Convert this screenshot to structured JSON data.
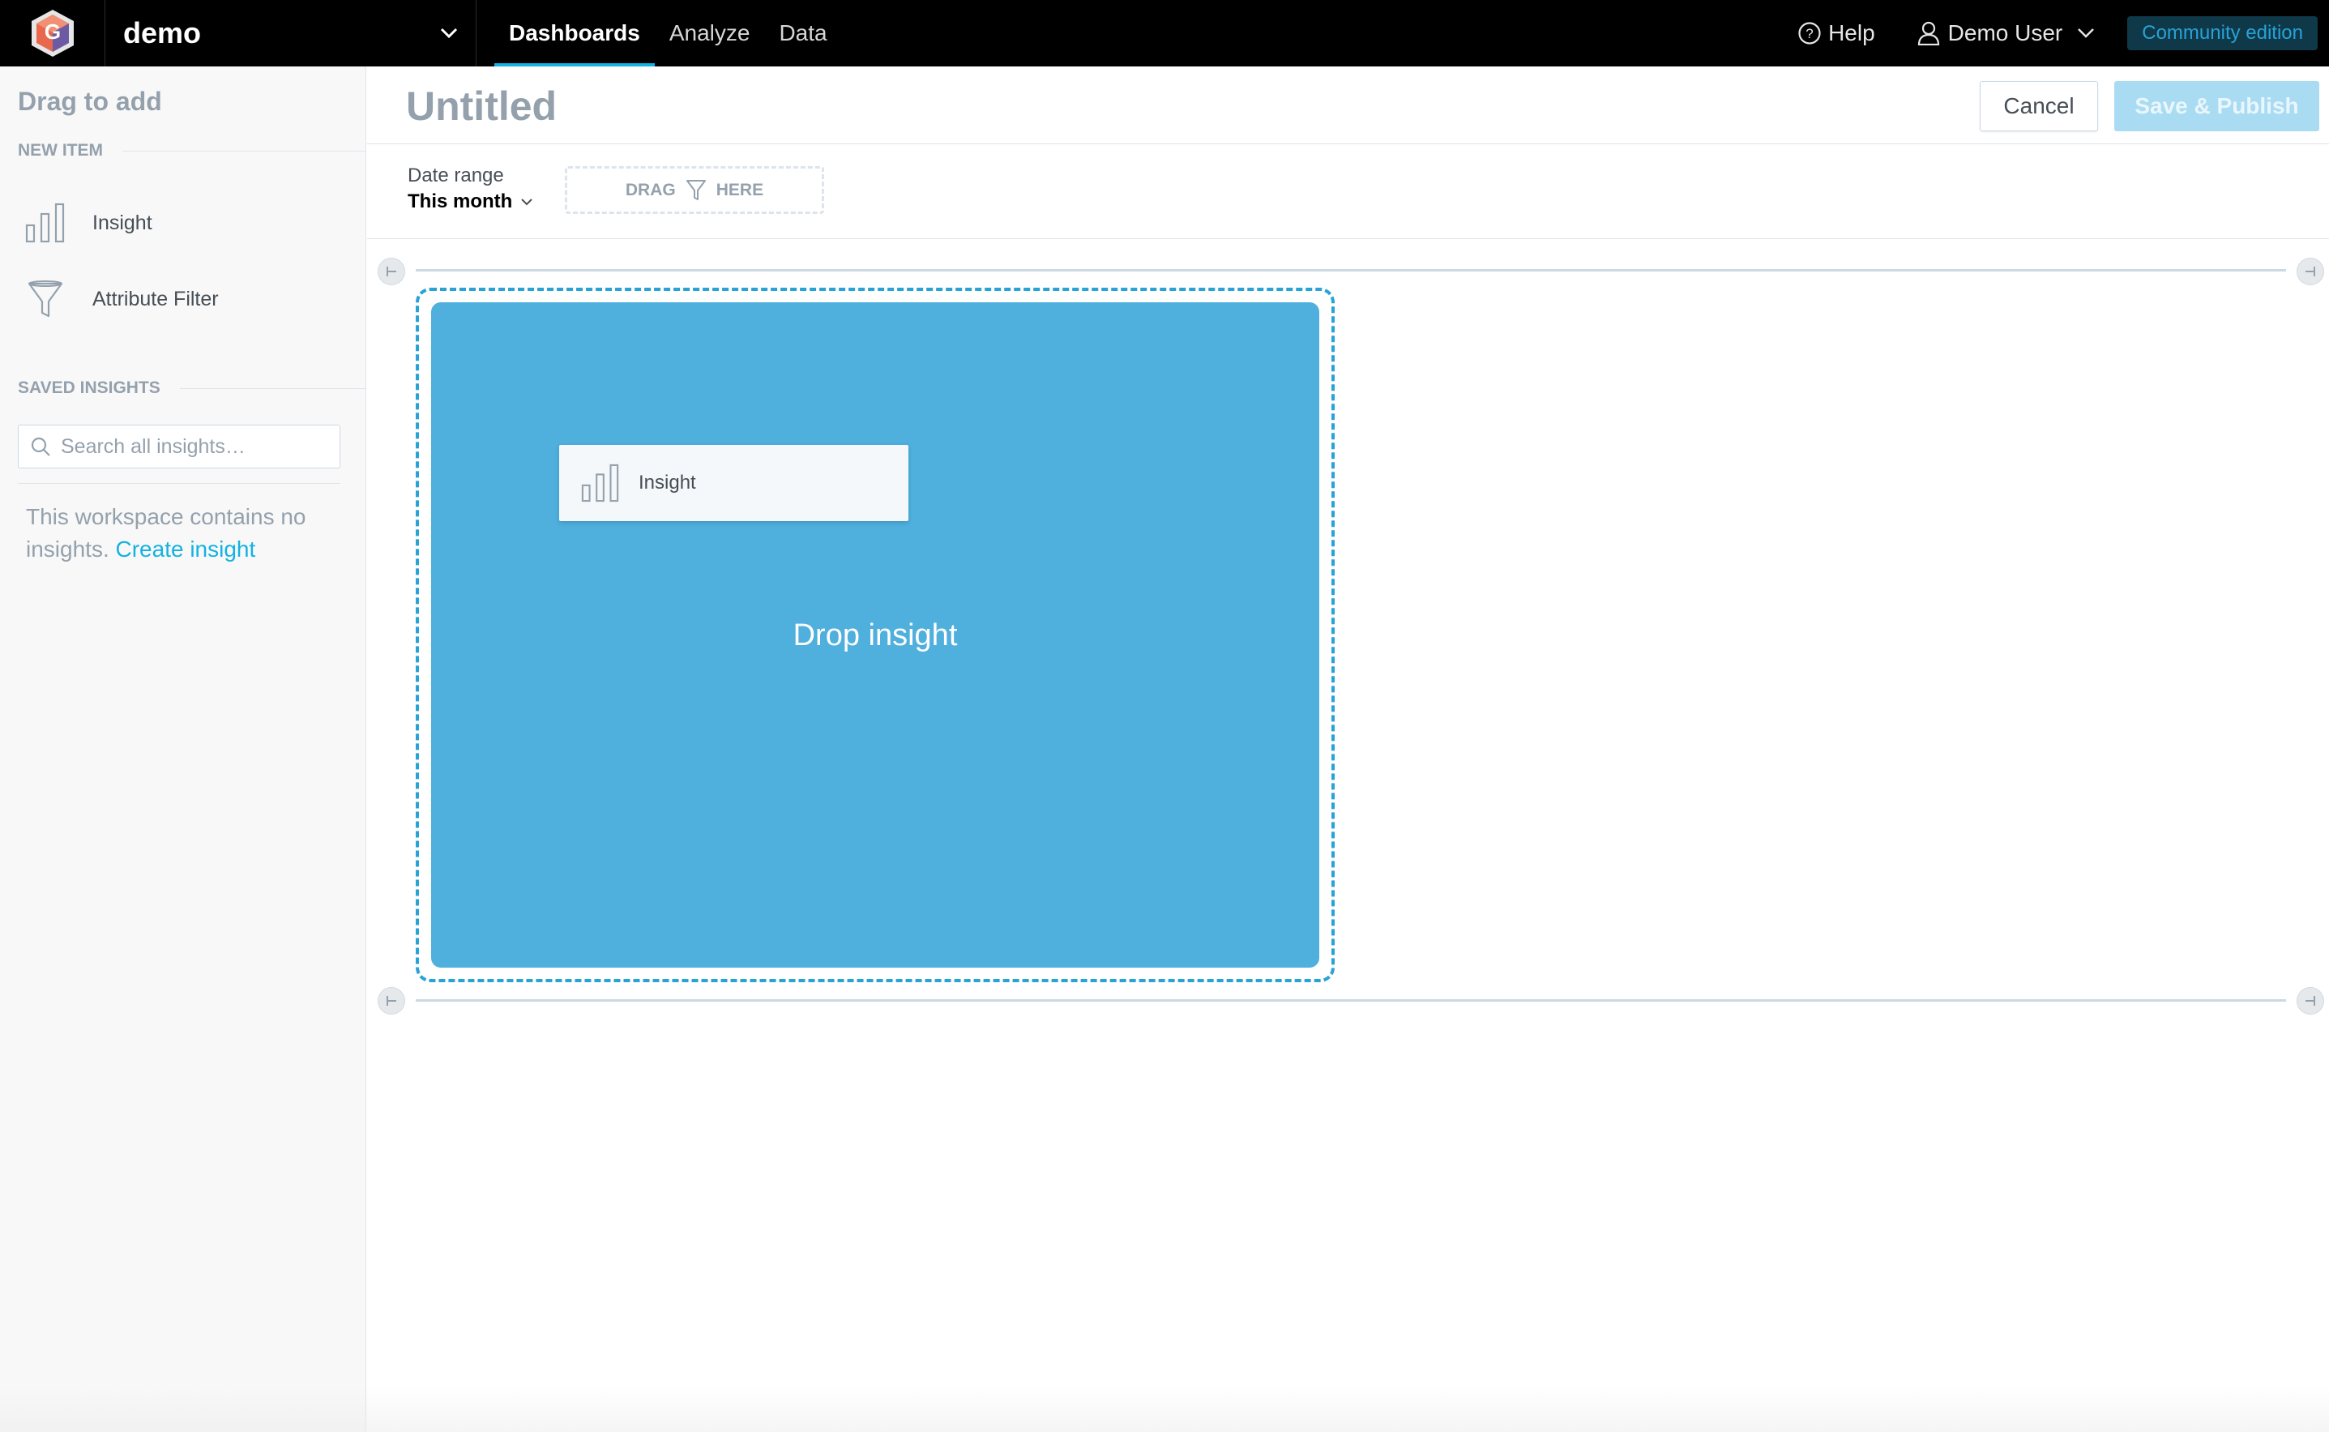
{
  "header": {
    "workspace_name": "demo",
    "nav": [
      {
        "label": "Dashboards",
        "active": true
      },
      {
        "label": "Analyze",
        "active": false
      },
      {
        "label": "Data",
        "active": false
      }
    ],
    "help_label": "Help",
    "user_name": "Demo User",
    "edition_badge": "Community edition"
  },
  "sidebar": {
    "title": "Drag to add",
    "new_item_label": "NEW ITEM",
    "new_items": [
      {
        "label": "Insight",
        "icon": "bar-chart-icon"
      },
      {
        "label": "Attribute Filter",
        "icon": "funnel-icon"
      }
    ],
    "saved_insights_label": "SAVED INSIGHTS",
    "search_placeholder": "Search all insights…",
    "empty_text": "This workspace contains no insights.",
    "create_link": "Create insight"
  },
  "dashboard": {
    "title": "Untitled",
    "cancel_label": "Cancel",
    "save_label": "Save & Publish"
  },
  "filters": {
    "date_label": "Date range",
    "date_value": "This month",
    "drag_prefix": "DRAG",
    "drag_suffix": "HERE"
  },
  "canvas": {
    "drop_text": "Drop insight",
    "drag_card_label": "Insight"
  },
  "colors": {
    "accent": "#14b2e2",
    "drop_fill": "#4fafdd",
    "header_bg": "#000000",
    "save_disabled": "#a9dcf3"
  }
}
